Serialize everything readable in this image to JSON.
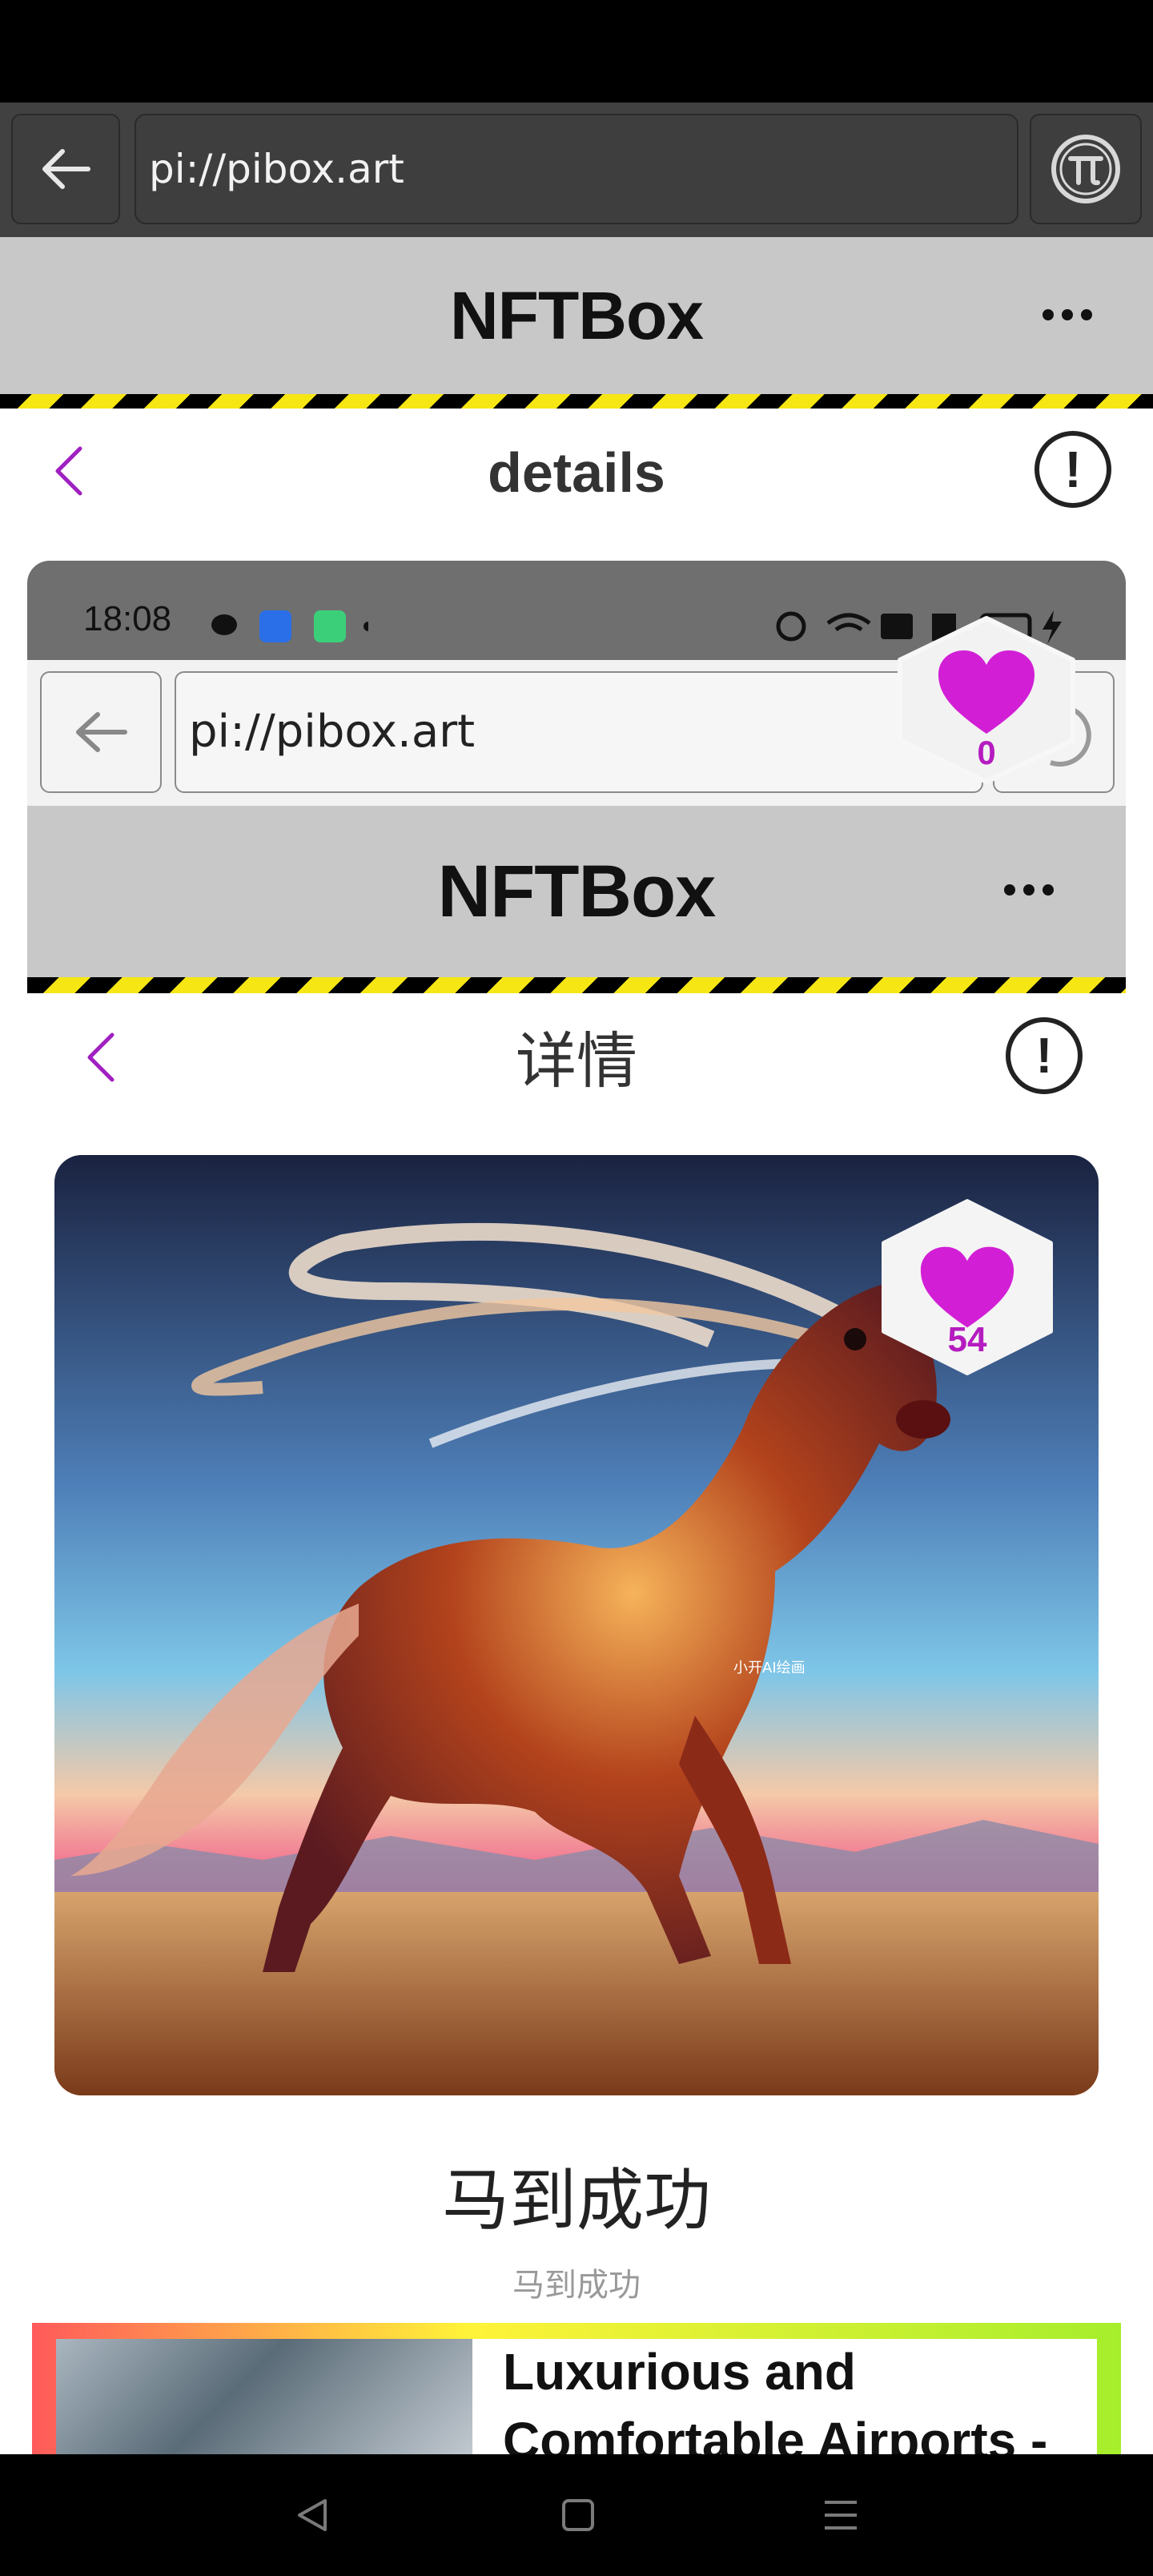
{
  "browser": {
    "url": "pi://pibox.art"
  },
  "app": {
    "title": "NFTBox"
  },
  "page": {
    "title": "details",
    "info_symbol": "!"
  },
  "embedded": {
    "status_time": "18:08",
    "url": "pi://pibox.art",
    "app_title": "NFTBox",
    "page_title": "详情",
    "info_symbol": "!",
    "like_count": "0",
    "artwork_like_count": "54",
    "watermark": "小开AI绘画",
    "nft_title": "马到成功",
    "nft_subtitle": "马到成功",
    "ad_title": "Luxurious and Comfortable Airports -"
  },
  "colors": {
    "accent_purple": "#a020c0",
    "heart_magenta": "#d21fd6",
    "hazard_yellow": "#f6e614"
  },
  "icons": {
    "back": "arrow-left-icon",
    "pi": "pi-logo-icon",
    "menu": "more-dots-icon",
    "chevron": "chevron-left-icon",
    "info": "info-circle-icon",
    "heart": "heart-icon",
    "nav_back": "triangle-back-icon",
    "nav_home": "square-home-icon",
    "nav_menu": "lines-menu-icon"
  }
}
